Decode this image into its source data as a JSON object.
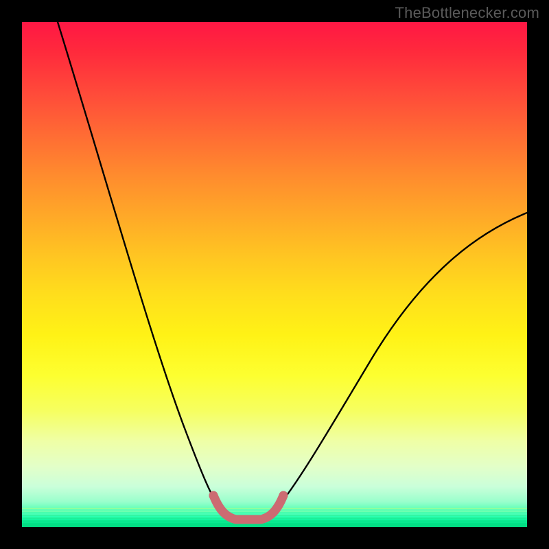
{
  "watermark": "TheBottlenecker.com",
  "colors": {
    "curve_main": "#000000",
    "curve_highlight": "#cc6b72",
    "frame": "#000000"
  },
  "chart_data": {
    "type": "line",
    "title": "",
    "xlabel": "",
    "ylabel": "",
    "xlim": [
      0,
      1
    ],
    "ylim": [
      0,
      1
    ],
    "series": [
      {
        "name": "bottleneck-curve",
        "x": [
          0.0,
          0.05,
          0.1,
          0.15,
          0.2,
          0.25,
          0.3,
          0.35,
          0.38,
          0.4,
          0.42,
          0.45,
          0.48,
          0.5,
          0.55,
          0.6,
          0.65,
          0.7,
          0.75,
          0.8,
          0.85,
          0.9,
          0.95,
          1.0
        ],
        "y": [
          1.0,
          0.86,
          0.72,
          0.58,
          0.44,
          0.31,
          0.19,
          0.09,
          0.04,
          0.02,
          0.01,
          0.01,
          0.02,
          0.04,
          0.11,
          0.19,
          0.27,
          0.34,
          0.4,
          0.46,
          0.51,
          0.55,
          0.59,
          0.62
        ]
      },
      {
        "name": "bottleneck-optimal-region",
        "x": [
          0.37,
          0.39,
          0.41,
          0.43,
          0.45,
          0.47,
          0.49
        ],
        "y": [
          0.05,
          0.022,
          0.012,
          0.01,
          0.012,
          0.022,
          0.05
        ]
      }
    ],
    "annotations": []
  }
}
